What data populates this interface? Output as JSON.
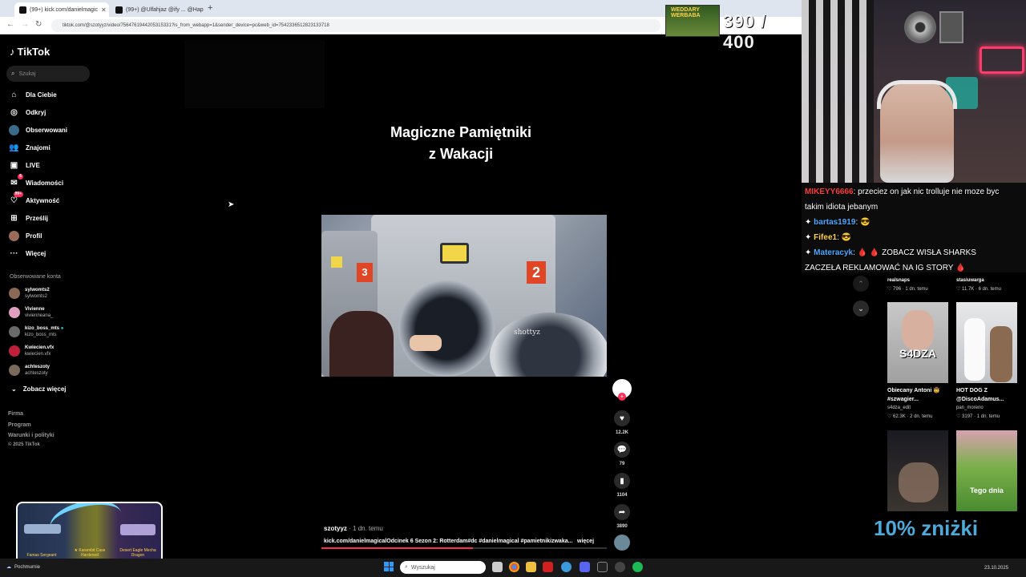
{
  "browser": {
    "tabs": [
      {
        "label": "(99+) kick.com/danielmagic"
      },
      {
        "label": "(99+) @Ulfahjaz @ify ... @Hap"
      }
    ],
    "new_tab": "+",
    "url": "tiktok.com/@szotyyz/video/7564761944205315331?is_from_webapp=1&sender_device=pc&web_id=7542336512823133718"
  },
  "sidebar": {
    "logo": "TikTok",
    "search_placeholder": "Szukaj",
    "nav": [
      {
        "label": "Dla Ciebie",
        "icon": "home-icon"
      },
      {
        "label": "Odkryj",
        "icon": "compass-icon"
      },
      {
        "label": "Obserwowani",
        "icon": "followed-avatar-icon"
      },
      {
        "label": "Znajomi",
        "icon": "friends-icon"
      },
      {
        "label": "LIVE",
        "icon": "live-icon"
      },
      {
        "label": "Wiadomości",
        "icon": "messages-icon",
        "badge": "6"
      },
      {
        "label": "Aktywność",
        "icon": "activity-icon",
        "badge": "99+"
      },
      {
        "label": "Prześlij",
        "icon": "upload-icon"
      },
      {
        "label": "Profil",
        "icon": "profile-avatar-icon"
      },
      {
        "label": "Więcej",
        "icon": "more-icon"
      }
    ],
    "followed_title": "Obserwowane konta",
    "accounts": [
      {
        "name": "sylwomts2",
        "handle": "sylwomts2",
        "color": "#8a6a55"
      },
      {
        "name": "Vivienne",
        "handle": "vivienneana_",
        "color": "#e0a0c0"
      },
      {
        "name": "kizo_boss_mts",
        "handle": "kizo_boss_mts",
        "color": "#6a6a6a",
        "verified": true
      },
      {
        "name": "Kwiecien.vfx",
        "handle": "kwiecien.vfx",
        "color": "#c0203a"
      },
      {
        "name": "achteszoty",
        "handle": "achteszoty",
        "color": "#7a6a5a"
      }
    ],
    "see_more": "Zobacz więcej",
    "footer": [
      "Firma",
      "Program",
      "Warunki i polityki",
      "© 2025 TikTok"
    ]
  },
  "video": {
    "title_line1": "Magiczne Pamiętniki",
    "title_line2": "z Wakacji",
    "watermark": "shottyz",
    "author": "szotyyz",
    "time": " · 1 dn. temu",
    "caption": "kick.com/danielmagicalOdcinek 6 Sezon 2: Rotterdam#dc #danielmagical #pamietnikizwaka...",
    "more": "więcej",
    "progress": 0.53,
    "machine_numbers": [
      "3",
      "2"
    ],
    "actions": {
      "likes": "12.2K",
      "comments": "79",
      "saves": "1104",
      "shares": "3890"
    }
  },
  "stream": {
    "score": "390 / 400",
    "score_banner": "WEDDARY WERBABA",
    "chat": [
      {
        "user": "MIKEYY6666",
        "text": ": przeciez on jak nic trolluje nie moze byc"
      },
      {
        "user": "",
        "text": "takim idiota jebanym"
      },
      {
        "user": "bartas1919",
        "text": ": 😎"
      },
      {
        "user": "Fifee1",
        "text": ": 😎"
      },
      {
        "user": "Materacyk",
        "text": ": 🩸 🩸 ZOBACZ WISŁA SHARKS"
      },
      {
        "user": "",
        "text": "ZACZEŁA REKLAMOWAĆ NA IG STORY 🩸"
      }
    ],
    "promo": "10% zniżki"
  },
  "feed": {
    "top_row": [
      {
        "user": "realsnaps",
        "likes": "796",
        "time": "1 dn. temu"
      },
      {
        "user": "stasiuwarga",
        "likes": "11.7K",
        "time": "6 dn. temu"
      }
    ],
    "cards": [
      {
        "title": "Obiecany Antoni 🤠 #szwagier...",
        "user": "s4dza_edit",
        "likes": "62.3K",
        "time": "2 dn. temu",
        "thumb_text": "S4DZA"
      },
      {
        "title": "HOT DOG Z @DiscoAdamus...",
        "user": "pan_moreno",
        "likes": "3197",
        "time": "1 dn. temu",
        "thumb_text": ""
      },
      {
        "title": "",
        "user": "",
        "likes": "",
        "time": "",
        "thumb_text": ""
      },
      {
        "title": "",
        "user": "",
        "likes": "",
        "time": "",
        "thumb_text": "Tego dnia"
      }
    ]
  },
  "overlay": {
    "guns": [
      "Famas Sergeant",
      "★ Karambit Case Hardened",
      "Desert Eagle Mecha Dragon"
    ]
  },
  "taskbar": {
    "weather": "Pochmurnie",
    "search_placeholder": "Wyszukaj",
    "clock": "23.10.2025"
  }
}
